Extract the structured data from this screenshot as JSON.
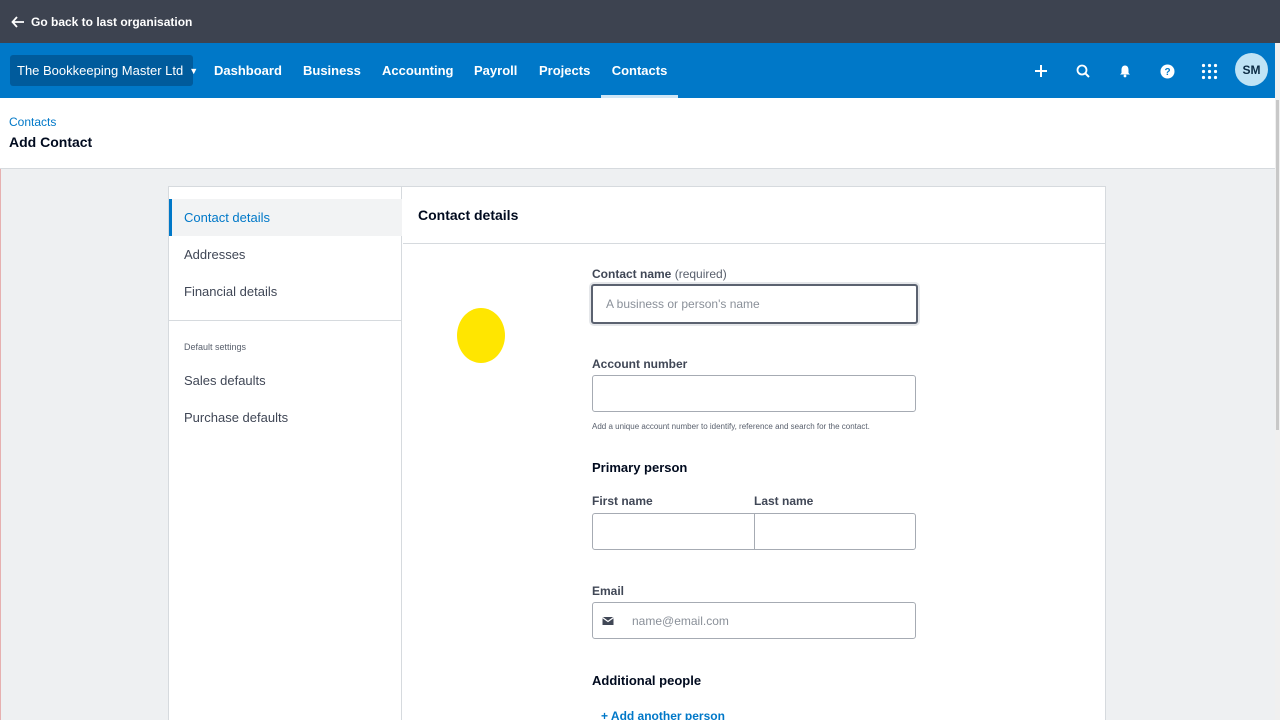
{
  "topbar": {
    "back_label": "Go back to last organisation"
  },
  "navbar": {
    "org_name": "The Bookkeeping Master Ltd",
    "links": [
      {
        "label": "Dashboard"
      },
      {
        "label": "Business"
      },
      {
        "label": "Accounting"
      },
      {
        "label": "Payroll"
      },
      {
        "label": "Projects"
      },
      {
        "label": "Contacts",
        "active": true
      }
    ],
    "icons": [
      "plus-icon",
      "search-icon",
      "bell-icon",
      "help-icon",
      "apps-grid-icon"
    ],
    "avatar_initials": "SM"
  },
  "page": {
    "breadcrumb": "Contacts",
    "title": "Add Contact"
  },
  "sidebar": {
    "items": [
      {
        "label": "Contact details",
        "active": true
      },
      {
        "label": "Addresses"
      },
      {
        "label": "Financial details"
      }
    ],
    "section_label": "Default settings",
    "default_items": [
      {
        "label": "Sales defaults"
      },
      {
        "label": "Purchase defaults"
      }
    ]
  },
  "form": {
    "heading": "Contact details",
    "contact_name": {
      "label": "Contact name",
      "required": "(required)",
      "placeholder": "A business or person's name",
      "value": ""
    },
    "account_number": {
      "label": "Account number",
      "value": "",
      "hint": "Add a unique account number to identify, reference and search for the contact."
    },
    "primary_person": {
      "heading": "Primary person",
      "first_name_label": "First name",
      "last_name_label": "Last name"
    },
    "email": {
      "label": "Email",
      "placeholder": "name@email.com"
    },
    "additional_people": {
      "heading": "Additional people",
      "add_link": "+ Add another person"
    }
  },
  "colors": {
    "brand": "#0078c8",
    "topbar": "#3d4350",
    "org_button": "#005b9c",
    "cursor_highlight": "#ffe600"
  }
}
